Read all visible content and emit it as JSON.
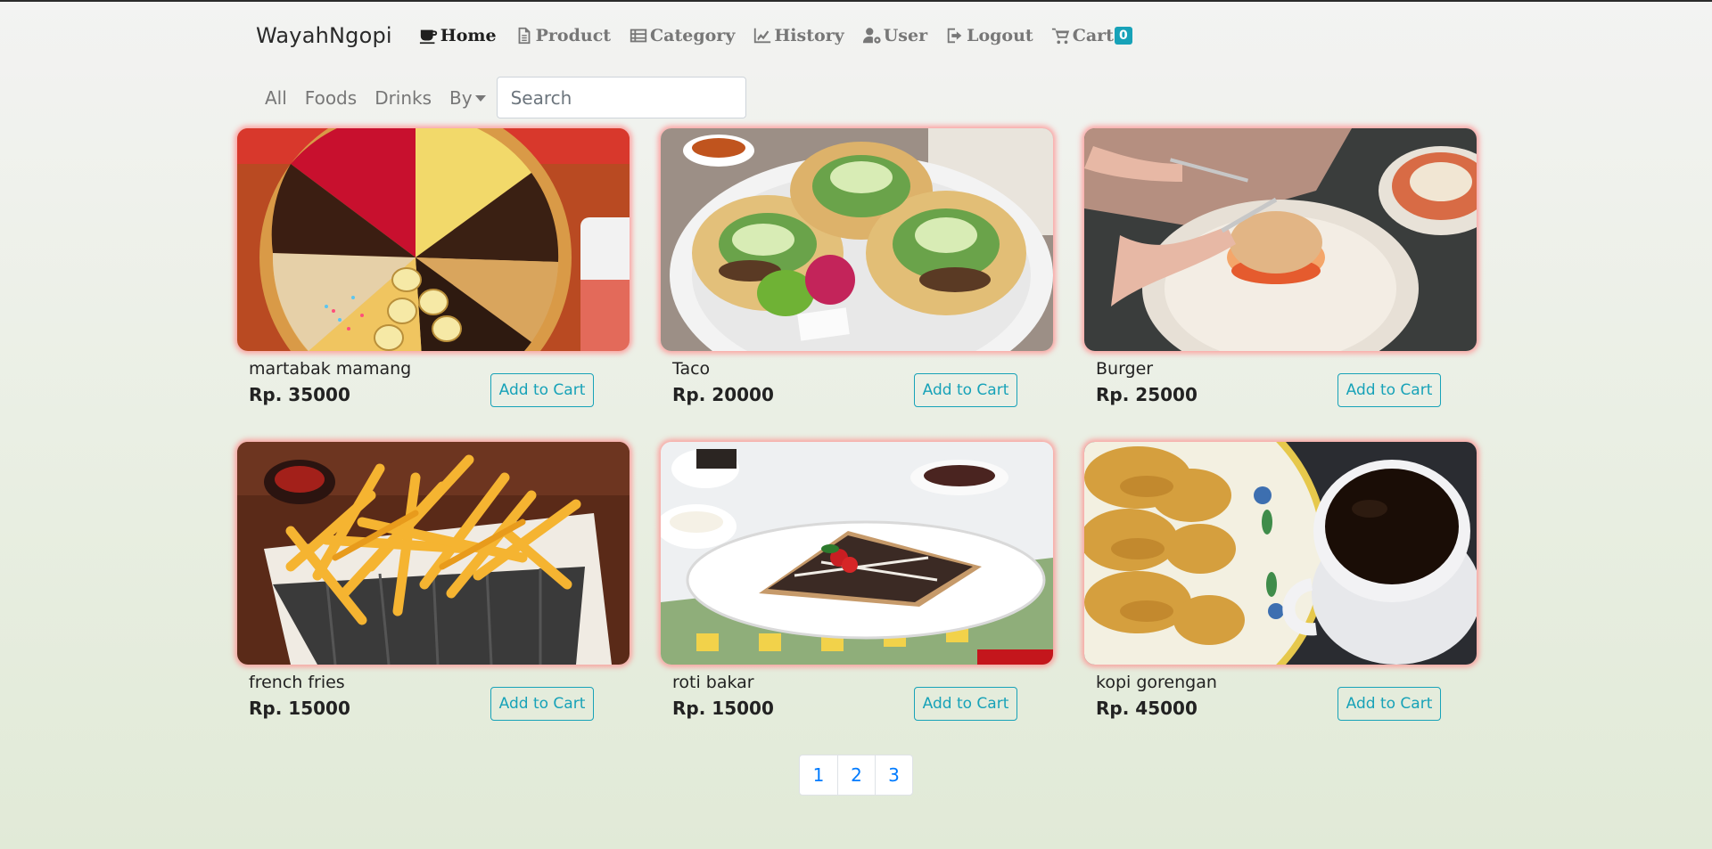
{
  "nav": {
    "brand": "WayahNgopi",
    "items": [
      {
        "label": "Home",
        "icon": "coffee-icon"
      },
      {
        "label": "Product",
        "icon": "file-icon"
      },
      {
        "label": "Category",
        "icon": "list-icon"
      },
      {
        "label": "History",
        "icon": "chart-line-icon"
      },
      {
        "label": "User",
        "icon": "user-cog-icon"
      },
      {
        "label": "Logout",
        "icon": "sign-out-icon"
      },
      {
        "label": "Cart",
        "icon": "cart-icon"
      }
    ],
    "cart_count": "0"
  },
  "filters": {
    "all": "All",
    "foods": "Foods",
    "drinks": "Drinks",
    "by": "By",
    "search_placeholder": "Search"
  },
  "products": [
    {
      "name": "martabak mamang",
      "price": "Rp. 35000",
      "button": "Add to Cart"
    },
    {
      "name": "Taco",
      "price": "Rp. 20000",
      "button": "Add to Cart"
    },
    {
      "name": "Burger",
      "price": "Rp. 25000",
      "button": "Add to Cart"
    },
    {
      "name": "french fries",
      "price": "Rp. 15000",
      "button": "Add to Cart"
    },
    {
      "name": "roti bakar",
      "price": "Rp. 15000",
      "button": "Add to Cart"
    },
    {
      "name": "kopi gorengan",
      "price": "Rp. 45000",
      "button": "Add to Cart"
    }
  ],
  "pagination": [
    "1",
    "2",
    "3"
  ],
  "colors": {
    "accent": "#17a2b8",
    "link": "#007bff",
    "card_glow": "#ff8c8c"
  }
}
